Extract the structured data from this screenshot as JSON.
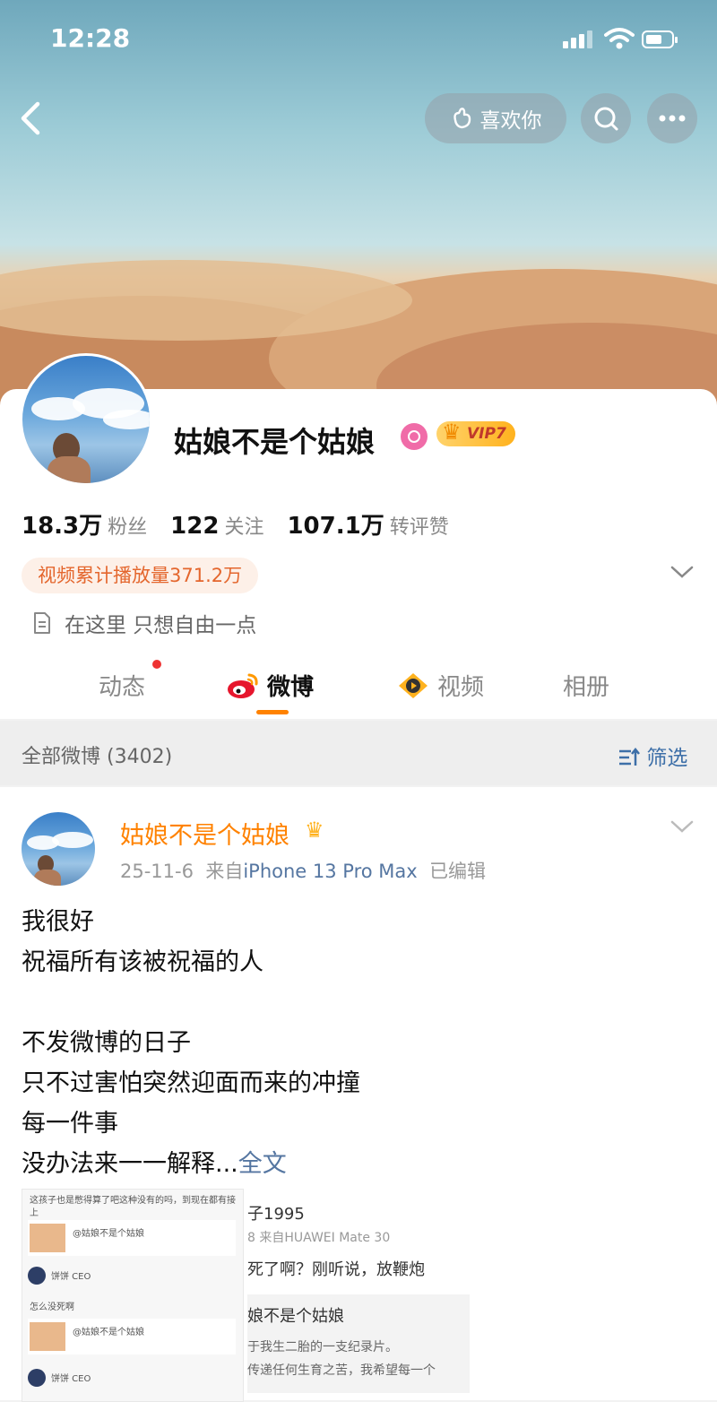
{
  "status_bar": {
    "time": "12:28"
  },
  "header": {
    "like_label": "喜欢你"
  },
  "profile": {
    "name": "姑娘不是个姑娘",
    "vip_label": "VIP7",
    "stats": [
      {
        "value": "18.3万",
        "label": "粉丝"
      },
      {
        "value": "122",
        "label": "关注"
      },
      {
        "value": "107.1万",
        "label": "转评赞"
      }
    ],
    "play_tag": "视频累计播放量371.2万",
    "bio": "在这里 只想自由一点",
    "tabs": [
      "动态",
      "微博",
      "视频",
      "相册"
    ]
  },
  "filter": {
    "all_label": "全部微博 (3402)",
    "filter_label": "筛选"
  },
  "post": {
    "author": "姑娘不是个姑娘",
    "date": "25-11-6",
    "from_label": "来自",
    "device": "iPhone 13 Pro Max",
    "edited": "已编辑",
    "lines": [
      "我很好",
      "祝福所有该被祝福的人",
      "",
      "不发微博的日子",
      "只不过害怕突然迎面而来的冲撞",
      "每一件事",
      "没办法来一一解释..."
    ],
    "more_label": "全文",
    "image_a": {
      "top_text": "这孩子也是憋得算了吧这种没有的吗，到现在都有接上",
      "card_title": "@姑娘不是个姑娘",
      "user": "饼饼 CEO",
      "reply": "怎么没死啊"
    },
    "image_b": {
      "line1": "子1995",
      "line2": "8  来自HUAWEI Mate 30",
      "line3": "死了啊？刚听说，放鞭炮",
      "line4": "娘不是个姑娘",
      "line5": "于我生二胎的一支纪录片。",
      "line6": "传递任何生育之苦，我希望每一个"
    }
  }
}
